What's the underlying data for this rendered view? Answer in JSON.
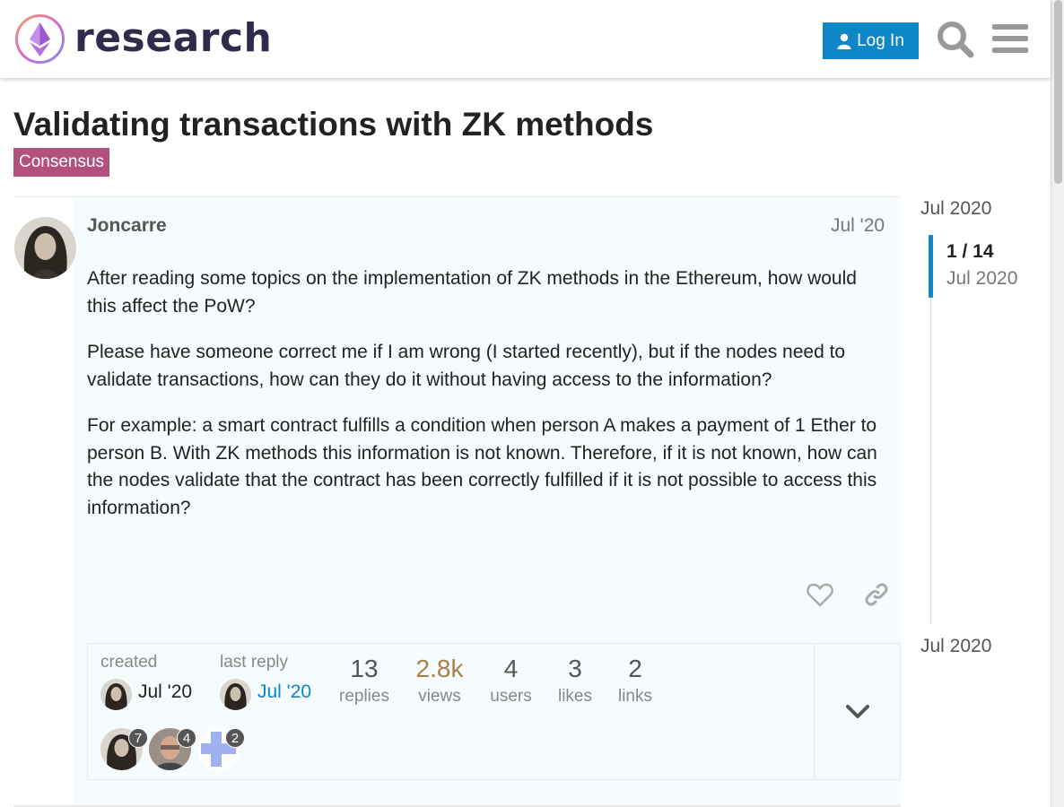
{
  "header": {
    "logo_text": "research",
    "login_label": "Log In"
  },
  "topic": {
    "title": "Validating transactions with ZK methods",
    "category": "Consensus",
    "category_color": "#b3507d"
  },
  "post": {
    "username": "Joncarre",
    "date": "Jul '20",
    "paragraphs": [
      "After reading some topics on the implementation of ZK methods in the Ethereum, how would this affect the PoW?",
      "Please have someone correct me if I am wrong (I started recently), but if the nodes need to validate transactions, how can they do it without having access to the information?",
      "For example: a smart contract fulfills a condition when person A makes a payment of 1 Ether to person B. With ZK methods this information is not known. Therefore, if it is not known, how can the nodes validate that the contract has been correctly fulfilled if it is not possible to access this information?"
    ]
  },
  "topic_map": {
    "created_label": "created",
    "created_date": "Jul '20",
    "last_reply_label": "last reply",
    "last_reply_date": "Jul '20",
    "stats": [
      {
        "num": "13",
        "label": "replies"
      },
      {
        "num": "2.8k",
        "label": "views"
      },
      {
        "num": "4",
        "label": "users"
      },
      {
        "num": "3",
        "label": "likes"
      },
      {
        "num": "2",
        "label": "links"
      }
    ],
    "participants": [
      {
        "count": "7"
      },
      {
        "count": "4"
      },
      {
        "count": "2"
      }
    ]
  },
  "timeline": {
    "top_date": "Jul 2020",
    "position": "1 / 14",
    "position_date": "Jul 2020",
    "bottom_date": "Jul 2020"
  },
  "colors": {
    "accent": "#0e86c7",
    "views_highlight": "#a88048"
  }
}
